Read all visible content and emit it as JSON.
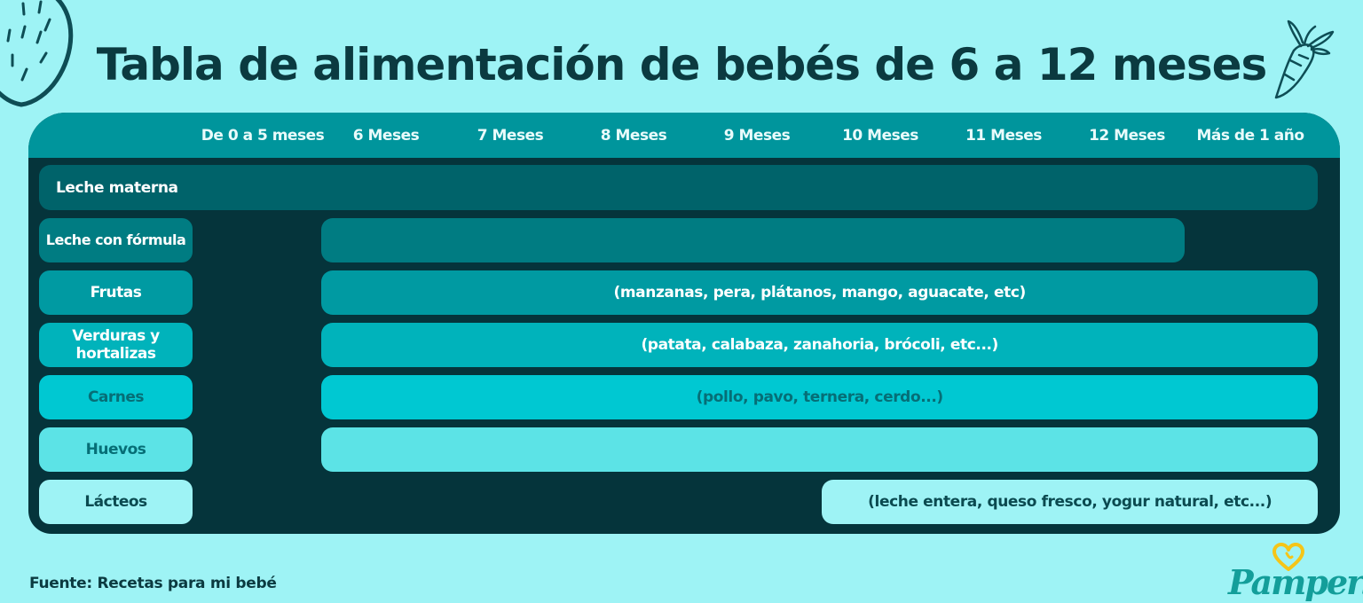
{
  "title": "Tabla de alimentación de bebés de 6 a 12 meses",
  "source": "Fuente: Recetas para mi bebé",
  "logo": {
    "name": "Pampers",
    "text": "Pampers",
    "colors": {
      "text": "#139e9a",
      "heart": "#f5c518"
    }
  },
  "colors": {
    "background": "#9ef3f5",
    "table_bg": "#05343b",
    "header_bg": "#00959c",
    "title": "#0b3a40"
  },
  "chart_data": {
    "type": "table",
    "title": "Tabla de alimentación de bebés de 6 a 12 meses",
    "columns": [
      "De 0 a 5 meses",
      "6 Meses",
      "7 Meses",
      "8 Meses",
      "9 Meses",
      "10 Meses",
      "11 Meses",
      "12 Meses",
      "Más de 1 año"
    ],
    "rows": [
      {
        "label": "Leche materna",
        "start": "De 0 a 5 meses",
        "end": "Más de 1 año",
        "start_index": 0,
        "end_index": 8,
        "note": "",
        "color": "#00636a",
        "label_color": "#ffffff",
        "text_color": "#ffffff",
        "label_merged": true
      },
      {
        "label": "Leche con fórmula",
        "start": "6 Meses",
        "end": "12 Meses",
        "start_index": 1,
        "end_index": 7,
        "note": "",
        "color": "#007c82",
        "label_color": "#ffffff",
        "text_color": "#ffffff"
      },
      {
        "label": "Frutas",
        "start": "6 Meses",
        "end": "Más de 1 año",
        "start_index": 1,
        "end_index": 8,
        "note": "(manzanas, pera, plátanos, mango, aguacate, etc)",
        "color": "#009aa2",
        "label_color": "#ffffff",
        "text_color": "#ffffff"
      },
      {
        "label": "Verduras y hortalizas",
        "start": "6 Meses",
        "end": "Más de 1 año",
        "start_index": 1,
        "end_index": 8,
        "note": "(patata, calabaza, zanahoria, brócoli, etc...)",
        "color": "#00b3bb",
        "label_color": "#ffffff",
        "text_color": "#ffffff"
      },
      {
        "label": "Carnes",
        "start": "6 Meses",
        "end": "Más de 1 año",
        "start_index": 1,
        "end_index": 8,
        "note": "(pollo, pavo, ternera, cerdo...)",
        "color": "#00c8d2",
        "label_color": "#066e76",
        "text_color": "#066e76"
      },
      {
        "label": "Huevos",
        "start": "6 Meses",
        "end": "Más de 1 año",
        "start_index": 1,
        "end_index": 8,
        "note": "",
        "color": "#5ce3e6",
        "label_color": "#066e76",
        "text_color": "#066e76"
      },
      {
        "label": "Lácteos",
        "start": "10 Meses",
        "end": "Más de 1 año",
        "start_index": 5,
        "end_index": 8,
        "note": "(leche entera, queso fresco, yogur natural, etc...)",
        "color": "#9ef3f5",
        "label_color": "#0b4a50",
        "text_color": "#0b4a50"
      }
    ]
  }
}
